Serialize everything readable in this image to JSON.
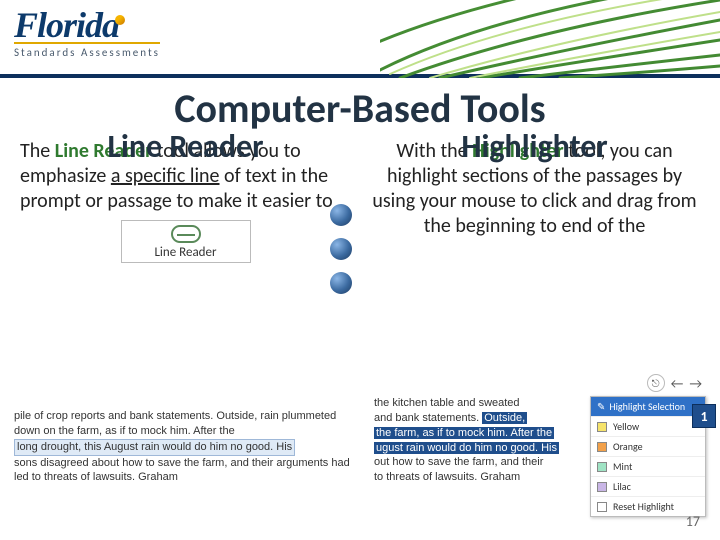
{
  "brand": {
    "name": "Florida",
    "sub": "Standards Assessments"
  },
  "title": "Computer-Based Tools",
  "left": {
    "heading": "Line Reader",
    "body_1": "The ",
    "kw": "Line Reader",
    "body_2": " tool allows you to emphasize ",
    "ul": "a specific line",
    "body_3": " of text in the prompt or passage to make it easier to",
    "box_label": "Line Reader"
  },
  "right": {
    "heading": "Highlighter",
    "body_1": "With the ",
    "kw": "Highlighter",
    "body_2": " tool, you can highlight sections of the passages by using your mouse to click and drag from the beginning to end of the"
  },
  "passage": {
    "p1": "pile of crop reports and bank statements. Outside, rain plummeted down on the farm, as if to mock him. After the ",
    "hl": "long drought, this August rain would do him no good. His",
    "p2": " sons disagreed about how to save the farm, and their arguments had led to threats of lawsuits. Graham"
  },
  "hl_demo": {
    "toolbar_esc": "⎋",
    "line1a": "the kitchen table and sweated",
    "sel1": "Outside,",
    "line2a": "and bank statements. ",
    "sel2": "the farm, as if to mock him. After the",
    "sel3": "ugust rain would do him no good. His",
    "line5": "out how to save the farm, and their",
    "line6": "to threats of lawsuits. Graham",
    "menu_head": "Highlight Selection",
    "menu_items": [
      "Yellow",
      "Orange",
      "Mint",
      "Lilac",
      "Reset Highlight"
    ],
    "menu_colors": [
      "#f6e36b",
      "#f2a14a",
      "#9fe3c4",
      "#c9b6e6",
      "#ffffff"
    ]
  },
  "page_number": "17",
  "tick": "1"
}
